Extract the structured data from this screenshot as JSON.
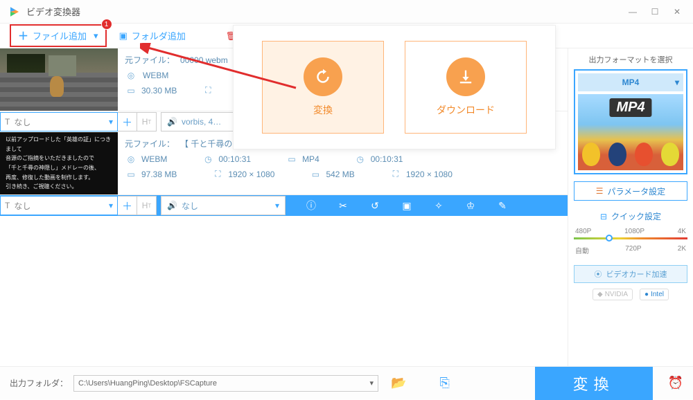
{
  "app": {
    "title": "ビデオ変換器"
  },
  "toolbar": {
    "file_add": "ファイル追加",
    "file_add_badge": "1",
    "folder_add": "フォルダ追加"
  },
  "rows": [
    {
      "src_label": "元ファイル：",
      "src_name": "00000.webm",
      "format": "WEBM",
      "size": "30.30 MB",
      "subtitle": "なし",
      "audio": "vorbis, 4…"
    },
    {
      "src_label": "元ファイル：",
      "src_name": "【 千と千尋の…",
      "thumb_lines": [
        "以前アップロードした「英雄の証」につきまして",
        "音源のご指摘をいただきましたので",
        "「千と千尋の神隠し」メドレーの後、",
        "再度、修復した動画を制作します。",
        "引き続き、ご視聴ください。"
      ],
      "format": "WEBM",
      "size": "97.38 MB",
      "duration_src": "00:10:31",
      "res_src": "1920 × 1080",
      "out_format": "MP4",
      "out_size": "542 MB",
      "out_duration": "00:10:31",
      "out_res": "1920 × 1080",
      "subtitle": "なし",
      "audio": "なし"
    }
  ],
  "overlay": {
    "convert": "変換",
    "download": "ダウンロード"
  },
  "right": {
    "title": "出力フォーマットを選択",
    "format": "MP4",
    "format_tab": "MP4",
    "param_label": "パラメータ設定",
    "quick_label": "クイック設定",
    "res_top": {
      "a": "480P",
      "b": "1080P",
      "c": "4K"
    },
    "res_bottom": {
      "a": "自動",
      "b": "720P",
      "c": "2K"
    },
    "gpu_label": "ビデオカード加速",
    "nvidia": "NVIDIA",
    "intel": "Intel"
  },
  "bottom": {
    "label": "出力フォルダ：",
    "path": "C:\\Users\\HuangPing\\Desktop\\FSCapture",
    "convert": "変換"
  }
}
